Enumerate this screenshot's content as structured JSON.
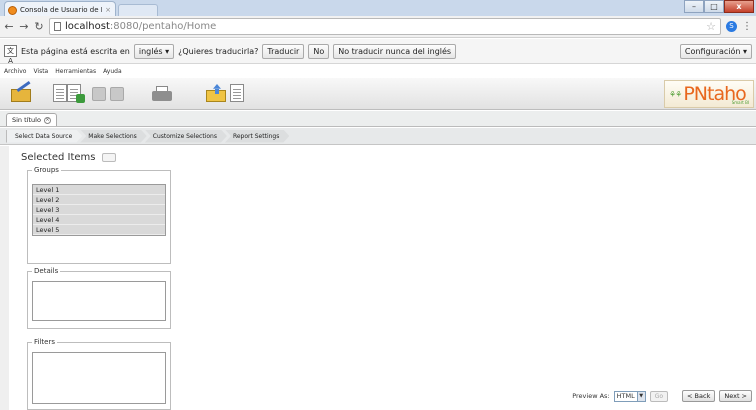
{
  "browser": {
    "tab_title": "Consola de Usuario de Per",
    "tab_close": "×",
    "url_host": "localhost",
    "url_path": ":8080/pentaho/Home",
    "window": {
      "minimize": "–",
      "maximize": "□",
      "close": "x"
    }
  },
  "translate_bar": {
    "message": "Esta página está escrita en",
    "language": "inglés ▾",
    "question": "¿Quieres traducirla?",
    "translate_btn": "Traducir",
    "no_btn": "No",
    "never_btn": "No traducir nunca del inglés",
    "config_btn": "Configuración ▾"
  },
  "menu": [
    "Archivo",
    "Vista",
    "Herramientas",
    "Ayuda"
  ],
  "logo": {
    "figures": "⚘⚘",
    "text": "PNtaho",
    "sub": "Smart BI"
  },
  "report_tab": {
    "label": "Sin título",
    "close": "×"
  },
  "wizard_steps": [
    "Select Data Source",
    "Make Selections",
    "Customize Selections",
    "Report Settings"
  ],
  "content": {
    "selected_items_title": "Selected Items",
    "groups_legend": "Groups",
    "groups": [
      "Level 1",
      "Level 2",
      "Level 3",
      "Level 4",
      "Level 5"
    ],
    "details_legend": "Details",
    "filters_legend": "Filters"
  },
  "footer": {
    "preview_label": "Preview As:",
    "preview_value": "HTML",
    "go_btn": "Go",
    "back_btn": "< Back",
    "next_btn": "Next >"
  }
}
